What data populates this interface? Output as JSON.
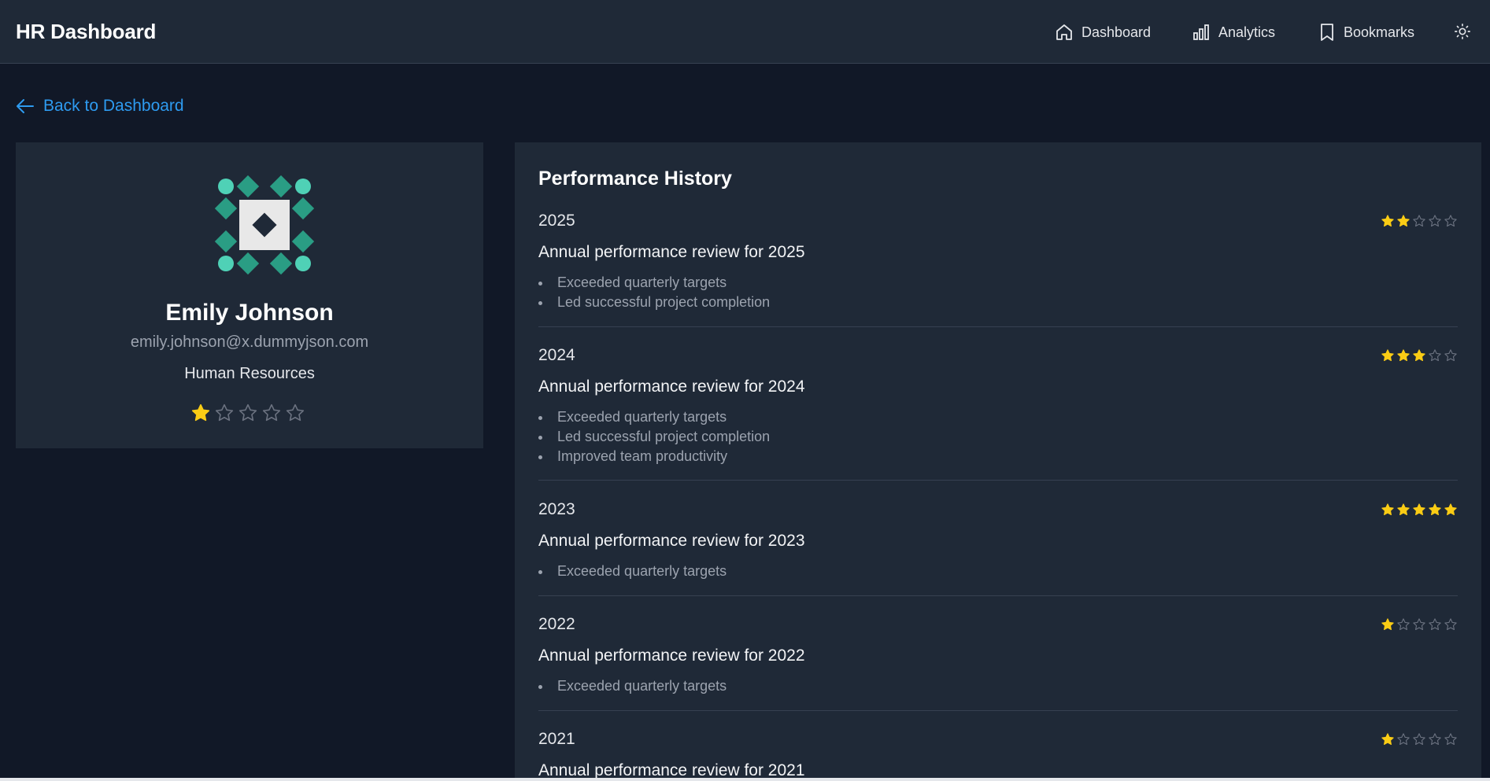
{
  "app": {
    "title": "HR Dashboard"
  },
  "nav": {
    "items": [
      {
        "label": "Dashboard",
        "icon": "home-icon"
      },
      {
        "label": "Analytics",
        "icon": "bar-chart-icon"
      },
      {
        "label": "Bookmarks",
        "icon": "bookmark-icon"
      }
    ],
    "theme_toggle_icon": "sun-icon"
  },
  "back_link": {
    "label": "Back to Dashboard"
  },
  "profile": {
    "name": "Emily Johnson",
    "email": "emily.johnson@x.dummyjson.com",
    "department": "Human Resources",
    "rating": 1,
    "rating_max": 5
  },
  "history": {
    "title": "Performance History",
    "reviews": [
      {
        "year": "2025",
        "description": "Annual performance review for 2025",
        "rating": 2,
        "highlights": [
          "Exceeded quarterly targets",
          "Led successful project completion"
        ]
      },
      {
        "year": "2024",
        "description": "Annual performance review for 2024",
        "rating": 3,
        "highlights": [
          "Exceeded quarterly targets",
          "Led successful project completion",
          "Improved team productivity"
        ]
      },
      {
        "year": "2023",
        "description": "Annual performance review for 2023",
        "rating": 5,
        "highlights": [
          "Exceeded quarterly targets"
        ]
      },
      {
        "year": "2022",
        "description": "Annual performance review for 2022",
        "rating": 1,
        "highlights": [
          "Exceeded quarterly targets"
        ]
      },
      {
        "year": "2021",
        "description": "Annual performance review for 2021",
        "rating": 1,
        "highlights": []
      }
    ]
  },
  "colors": {
    "page_bg": "#111827",
    "card_bg": "#1f2937",
    "accent_link": "#2e9bf0",
    "star_filled": "#facc15",
    "star_empty": "#6b7280"
  }
}
